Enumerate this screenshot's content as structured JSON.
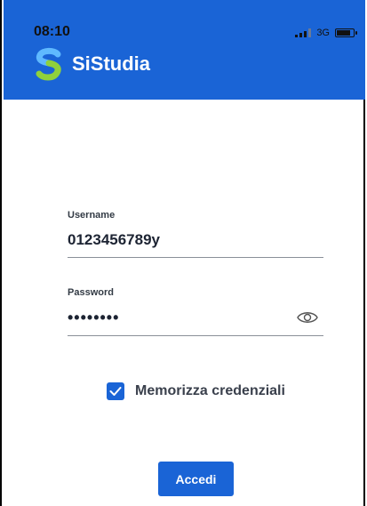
{
  "status_bar": {
    "time": "08:10",
    "network": "3G"
  },
  "app": {
    "name": "SiStudia"
  },
  "form": {
    "username_label": "Username",
    "username_value": "0123456789y",
    "password_label": "Password",
    "password_value": "••••••••",
    "remember_label": "Memorizza credenziali",
    "remember_checked": true,
    "login_label": "Accedi"
  },
  "colors": {
    "primary": "#1a64d6",
    "text": "#1d2433"
  }
}
